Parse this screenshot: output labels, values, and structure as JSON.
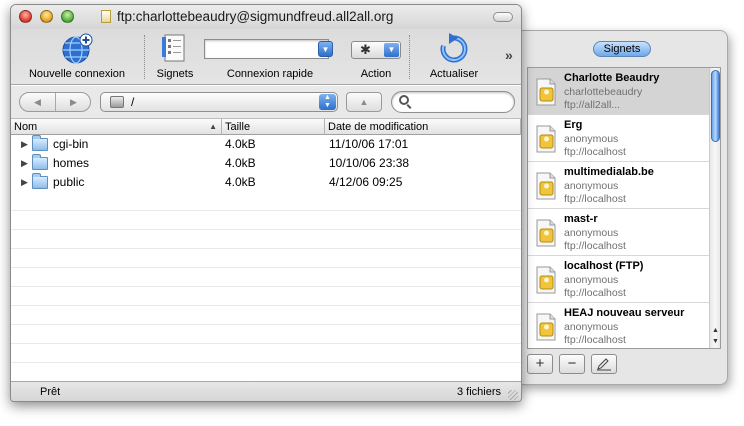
{
  "window": {
    "title": "ftp:charlottebeaudry@sigmundfreud.all2all.org"
  },
  "toolbar": {
    "new_connection_label": "Nouvelle connexion",
    "bookmarks_label": "Signets",
    "quick_connect_label": "Connexion rapide",
    "quick_connect_value": "",
    "action_label": "Action",
    "refresh_label": "Actualiser"
  },
  "pathbar": {
    "path": "/",
    "search_value": ""
  },
  "table": {
    "columns": [
      "Nom",
      "Taille",
      "Date de modification"
    ],
    "rows": [
      {
        "name": "cgi-bin",
        "size": "4.0kB",
        "modified": "11/10/06 17:01"
      },
      {
        "name": "homes",
        "size": "4.0kB",
        "modified": "10/10/06 23:38"
      },
      {
        "name": "public",
        "size": "4.0kB",
        "modified": "4/12/06 09:25"
      }
    ]
  },
  "status": {
    "left": "Prêt",
    "right": "3 fichiers"
  },
  "drawer": {
    "title": "Signets",
    "bookmarks": [
      {
        "name": "Charlotte Beaudry",
        "user": "charlottebeaudry",
        "url": "ftp://all2all...",
        "selected": true
      },
      {
        "name": "Erg",
        "user": "anonymous",
        "url": "ftp://localhost"
      },
      {
        "name": "multimedialab.be",
        "user": "anonymous",
        "url": "ftp://localhost"
      },
      {
        "name": "mast-r",
        "user": "anonymous",
        "url": "ftp://localhost"
      },
      {
        "name": "localhost (FTP)",
        "user": "anonymous",
        "url": "ftp://localhost"
      },
      {
        "name": "HEAJ nouveau serveur",
        "user": "anonymous",
        "url": "ftp://localhost"
      }
    ]
  },
  "colors": {
    "accent": "#3a7bd5",
    "selection": "#d4d4d4"
  },
  "icons": [
    "globe-plus-icon",
    "bookmarks-icon",
    "gear-icon",
    "refresh-icon",
    "folder-icon",
    "search-icon",
    "server-icon"
  ]
}
